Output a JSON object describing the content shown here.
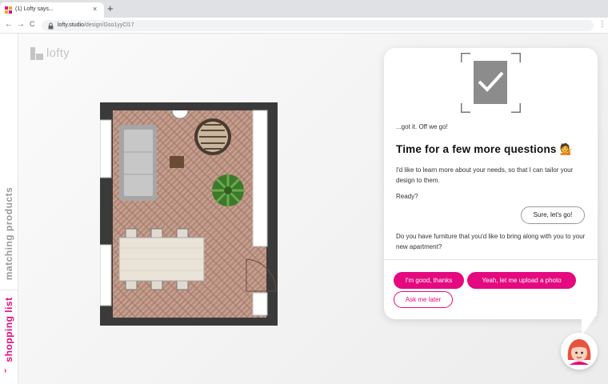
{
  "browser": {
    "tab_title": "(1) Lofty says...",
    "tab_close": "×",
    "new_tab": "+",
    "nav_back": "←",
    "nav_forward": "→",
    "nav_reload": "C",
    "url_host": "lofty.studio",
    "url_path": "/design/Gso1yyCl17",
    "menu": "⋮"
  },
  "sidebar": {
    "matching_label": "matching products",
    "shopping_label": "shopping list",
    "shopping_chevron": "›"
  },
  "logo": {
    "wordmark": "lofty"
  },
  "chat": {
    "ack": "...got it. Off we go!",
    "heading": "Time for a few more questions 💁",
    "intro": "I'd like to learn more about your needs, so that I can tailor your design to them.",
    "ready": "Ready?",
    "reply_sure": "Sure, let's go!",
    "question": "Do you have furniture that you'd like to bring along with you to your new apartment?",
    "option_good": "I'm good, thanks",
    "option_upload": "Yeah, let me upload a photo",
    "option_later": "Ask me later"
  },
  "colors": {
    "brand_pink": "#e5097f",
    "floor": "#b89080",
    "wall": "#3a3a3a",
    "sidebar_muted": "#9a9a9a"
  },
  "icons": {
    "tab_favicon": "lofty-favicon-icon",
    "lock": "lock-icon",
    "check": "checkmark-icon",
    "avatar": "assistant-avatar-icon"
  }
}
